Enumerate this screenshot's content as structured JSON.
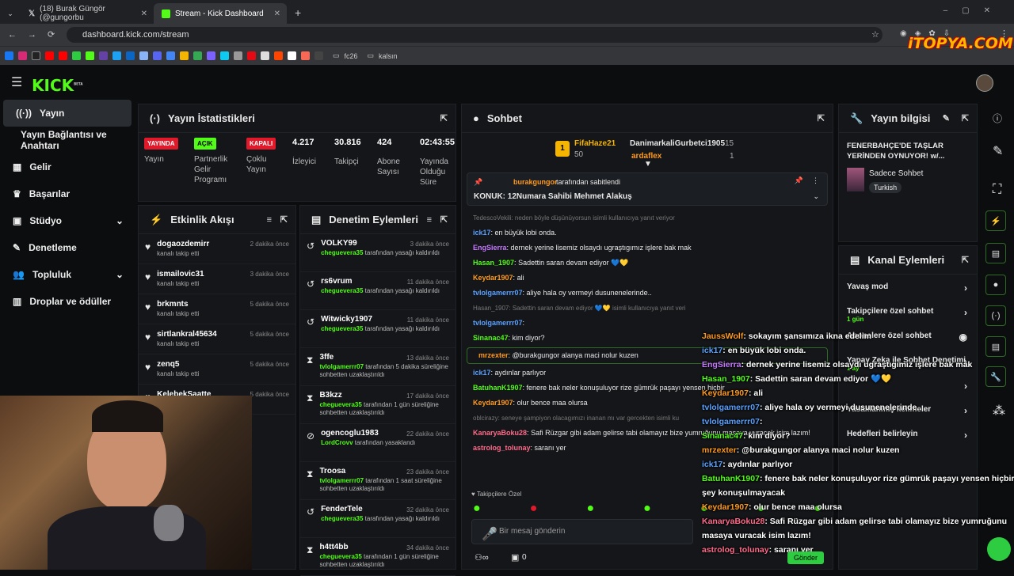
{
  "browser": {
    "tab1": "(18) Burak Güngör (@gungorbu",
    "tab2": "Stream - Kick Dashboard",
    "url": "dashboard.kick.com/stream",
    "bm1": "fc26",
    "bm2": "kalsın"
  },
  "watermark": "iTOPYA.COM",
  "brand": {
    "logo": "KICK",
    "beta": "BETA",
    "accent": "#53fc18"
  },
  "sidebar": {
    "items": [
      "Yayın",
      "Yayın Bağlantısı ve Anahtarı",
      "Gelir",
      "Başarılar",
      "Stüdyo",
      "Denetleme",
      "Topluluk",
      "Droplar ve ödüller"
    ]
  },
  "stats": {
    "title": "Yayın İstatistikleri",
    "badges": [
      {
        "t": "YAYINDA",
        "l": "Yayın"
      },
      {
        "t": "AÇIK",
        "l": "Partnerlik Gelir Programı"
      },
      {
        "t": "KAPALI",
        "l": "Çoklu Yayın"
      }
    ],
    "nums": [
      {
        "v": "4.217",
        "l": "İzleyici"
      },
      {
        "v": "30.816",
        "l": "Takipçi"
      },
      {
        "v": "424",
        "l": "Abone Sayısı"
      },
      {
        "v": "02:43:55",
        "l": "Yayında Olduğu Süre"
      }
    ]
  },
  "activity": {
    "title": "Etkinlik Akışı",
    "rows": [
      {
        "n": "dogaozdemirr",
        "s": "kanalı takip etti",
        "t": "2 dakika önce"
      },
      {
        "n": "ismailovic31",
        "s": "kanalı takip etti",
        "t": "3 dakika önce"
      },
      {
        "n": "brkmnts",
        "s": "kanalı takip etti",
        "t": "5 dakika önce"
      },
      {
        "n": "sirtlankral45634",
        "s": "kanalı takip etti",
        "t": "5 dakika önce"
      },
      {
        "n": "zenq5",
        "s": "kanalı takip etti",
        "t": "5 dakika önce"
      },
      {
        "n": "KelebekSaatte",
        "s": "",
        "t": "5 dakika önce"
      }
    ]
  },
  "moderation": {
    "title": "Denetim Eylemleri",
    "rows": [
      {
        "n": "VOLKY99",
        "s1": "cheguevera35",
        "s2": " tarafından yasağı kaldırıldı",
        "t": "3 dakika önce"
      },
      {
        "n": "rs6vrum",
        "s1": "cheguevera35",
        "s2": " tarafından yasağı kaldırıldı",
        "t": "11 dakika önce"
      },
      {
        "n": "Witwicky1907",
        "s1": "cheguevera35",
        "s2": " tarafından yasağı kaldırıldı",
        "t": "11 dakika önce"
      },
      {
        "n": "3ffe",
        "s1": "tvlolgamerrr07",
        "s2": " tarafından 5 dakika süreliğine sohbetten uzaklaştırıldı",
        "t": "13 dakika önce"
      },
      {
        "n": "B3kzz",
        "s1": "cheguevera35",
        "s2": " tarafından 1 gün süreliğine sohbetten uzaklaştırıldı",
        "t": "17 dakika önce"
      },
      {
        "n": "ogencoglu1983",
        "s1": "LordCrovv",
        "s2": " tarafından yasaklandı",
        "t": "22 dakika önce"
      },
      {
        "n": "Troosa",
        "s1": "tvlolgamerrr07",
        "s2": " tarafından 1 saat süreliğine sohbetten uzaklaştırıldı",
        "t": "23 dakika önce"
      },
      {
        "n": "FenderTele",
        "s1": "cheguevera35",
        "s2": " tarafından yasağı kaldırıldı",
        "t": "32 dakika önce"
      },
      {
        "n": "h4tt4bb",
        "s1": "cheguevera35",
        "s2": " tarafından 1 gün süreliğine sohbetten uzaklaştırıldı",
        "t": "34 dakika önce"
      }
    ]
  },
  "chat": {
    "title": "Sohbet",
    "top1": "FifaHaze21",
    "top1v": "50",
    "top2": "DanimarkaliGurbetci1905",
    "top2v": "15",
    "top3": "ardaflex",
    "top3v": "1",
    "pinned_by": "burakgungor",
    "pinned_suffix": " tarafından sabitlendi",
    "pinned": "KONUK: 12Numara Sahibi Mehmet Alakuş",
    "reply1": "TedescoVekili: neden böyle düşünüyorsun isimli kullanıcıya yanıt veriyor",
    "reply2": "Hasan_1907: Sadettin saran devam ediyor 💙💛 isimli kullanıcıya yanıt veri",
    "reply3": "oblcirazy: seneye şampiyon olacagımızı inanan mı var gercekten isimli ku",
    "lines": [
      {
        "u": "ick17",
        "c": "#5aa0ff",
        "m": "en büyük lobi onda."
      },
      {
        "u": "EngSierra",
        "c": "#c678ff",
        "m": "dernek yerine lisemiz olsaydı ugraştıgımız işlere bak mak"
      },
      {
        "u": "Hasan_1907",
        "c": "#53fc18",
        "m": "Sadettin saran devam ediyor 💙💛"
      },
      {
        "u": "Keydar1907",
        "c": "#ff9a1f",
        "m": "ali"
      },
      {
        "u": "tvlolgamerrr07",
        "c": "#5aa0ff",
        "m": "aliye hala oy vermeyi dusunenelerinde.."
      },
      {
        "u": "tvlolgamerrr07",
        "c": "#5aa0ff",
        "m": ""
      },
      {
        "u": "Sinanac47",
        "c": "#53fc18",
        "m": "kim diyor?"
      },
      {
        "u": "mrzexter",
        "c": "#ff9a1f",
        "m": "@burakgungor alanya maci nolur kuzen"
      },
      {
        "u": "ick17",
        "c": "#5aa0ff",
        "m": "aydınlar parlıyor"
      },
      {
        "u": "BatuhanK1907",
        "c": "#53fc18",
        "m": "fenere bak neler konuşuluyor rize gümrük paşayı yensen hiçbir"
      },
      {
        "u": "Keydar1907",
        "c": "#ff9a1f",
        "m": "olur bence maa olursa"
      },
      {
        "u": "KanaryaBoku28",
        "c": "#ff6b8a",
        "m": "Safi Rüzgar gibi adam gelirse tabi olamayız bize yumruğunu masaya vuracak isim lazım!"
      },
      {
        "u": "astrolog_tolunay",
        "c": "#ff6b8a",
        "m": "saranı yer"
      }
    ],
    "followers_only": "Takipçilere Özel",
    "placeholder": "Bir mesaj gönderin",
    "count": "0",
    "send": "Gönder"
  },
  "info": {
    "title": "Yayın bilgisi",
    "stream_title": "FENERBAHÇE'DE TAŞLAR YERİNDEN OYNUYOR! w/...",
    "category": "Sadece Sohbet",
    "language": "Turkish"
  },
  "channel": {
    "title": "Kanal Eylemleri",
    "items": [
      {
        "l": "Yavaş mod",
        "s": ""
      },
      {
        "l": "Takipçilere özel sohbet",
        "s": "1 gün"
      },
      {
        "l": "Abonelere özel sohbet",
        "s": ""
      },
      {
        "l": "Yapay Zeka ile Sohbet Denetimi",
        "s": "1 ay"
      },
      {
        "l": "",
        "s": ""
      },
      {
        "l": "Yasaklanmış kelimeler",
        "s": ""
      },
      {
        "l": "Hedefleri belirleyin",
        "s": ""
      }
    ],
    "embed1": "Engellenen terimler",
    "embed2": "Yayıncı yönlendir"
  },
  "overlay": [
    {
      "u": "JaussWolf",
      "c": "#ff9a1f",
      "m": ": sokayım şansımıza ikna edelim"
    },
    {
      "u": "ick17",
      "c": "#5aa0ff",
      "m": ": en büyük lobi onda."
    },
    {
      "u": "EngSierra",
      "c": "#c678ff",
      "m": ": dernek yerine lisemiz olsaydı ugraştıgımız işlere bak mak"
    },
    {
      "u": "Hasan_1907",
      "c": "#53fc18",
      "m": ": Sadettin saran devam ediyor 💙💛"
    },
    {
      "u": "Keydar1907",
      "c": "#ff9a1f",
      "m": ": ali"
    },
    {
      "u": "tvlolgamerrr07",
      "c": "#5aa0ff",
      "m": ": aliye hala oy vermeyi dusunenelerinde.."
    },
    {
      "u": "tvlolgamerrr07",
      "c": "#5aa0ff",
      "m": ":"
    },
    {
      "u": "Sinanac47",
      "c": "#53fc18",
      "m": ": kim diyor?"
    },
    {
      "u": "mrzexter",
      "c": "#ff9a1f",
      "m": ": @burakgungor alanya maci nolur kuzen"
    },
    {
      "u": "ick17",
      "c": "#5aa0ff",
      "m": ": aydınlar parlıyor"
    },
    {
      "u": "BatuhanK1907",
      "c": "#53fc18",
      "m": ": fenere bak neler konuşuluyor rize gümrük paşayı yensen hiçbir"
    },
    {
      "u": "",
      "c": "#fff",
      "m": "şey konuşulmayacak"
    },
    {
      "u": "Keydar1907",
      "c": "#ff9a1f",
      "m": ": olur bence maa olursa"
    },
    {
      "u": "KanaryaBoku28",
      "c": "#ff6b8a",
      "m": ": Safi Rüzgar gibi adam gelirse tabi olamayız bize yumruğunu"
    },
    {
      "u": "",
      "c": "#fff",
      "m": "masaya vuracak isim lazım!"
    },
    {
      "u": "astrolog_tolunay",
      "c": "#ff6b8a",
      "m": ": saranı yer"
    }
  ]
}
